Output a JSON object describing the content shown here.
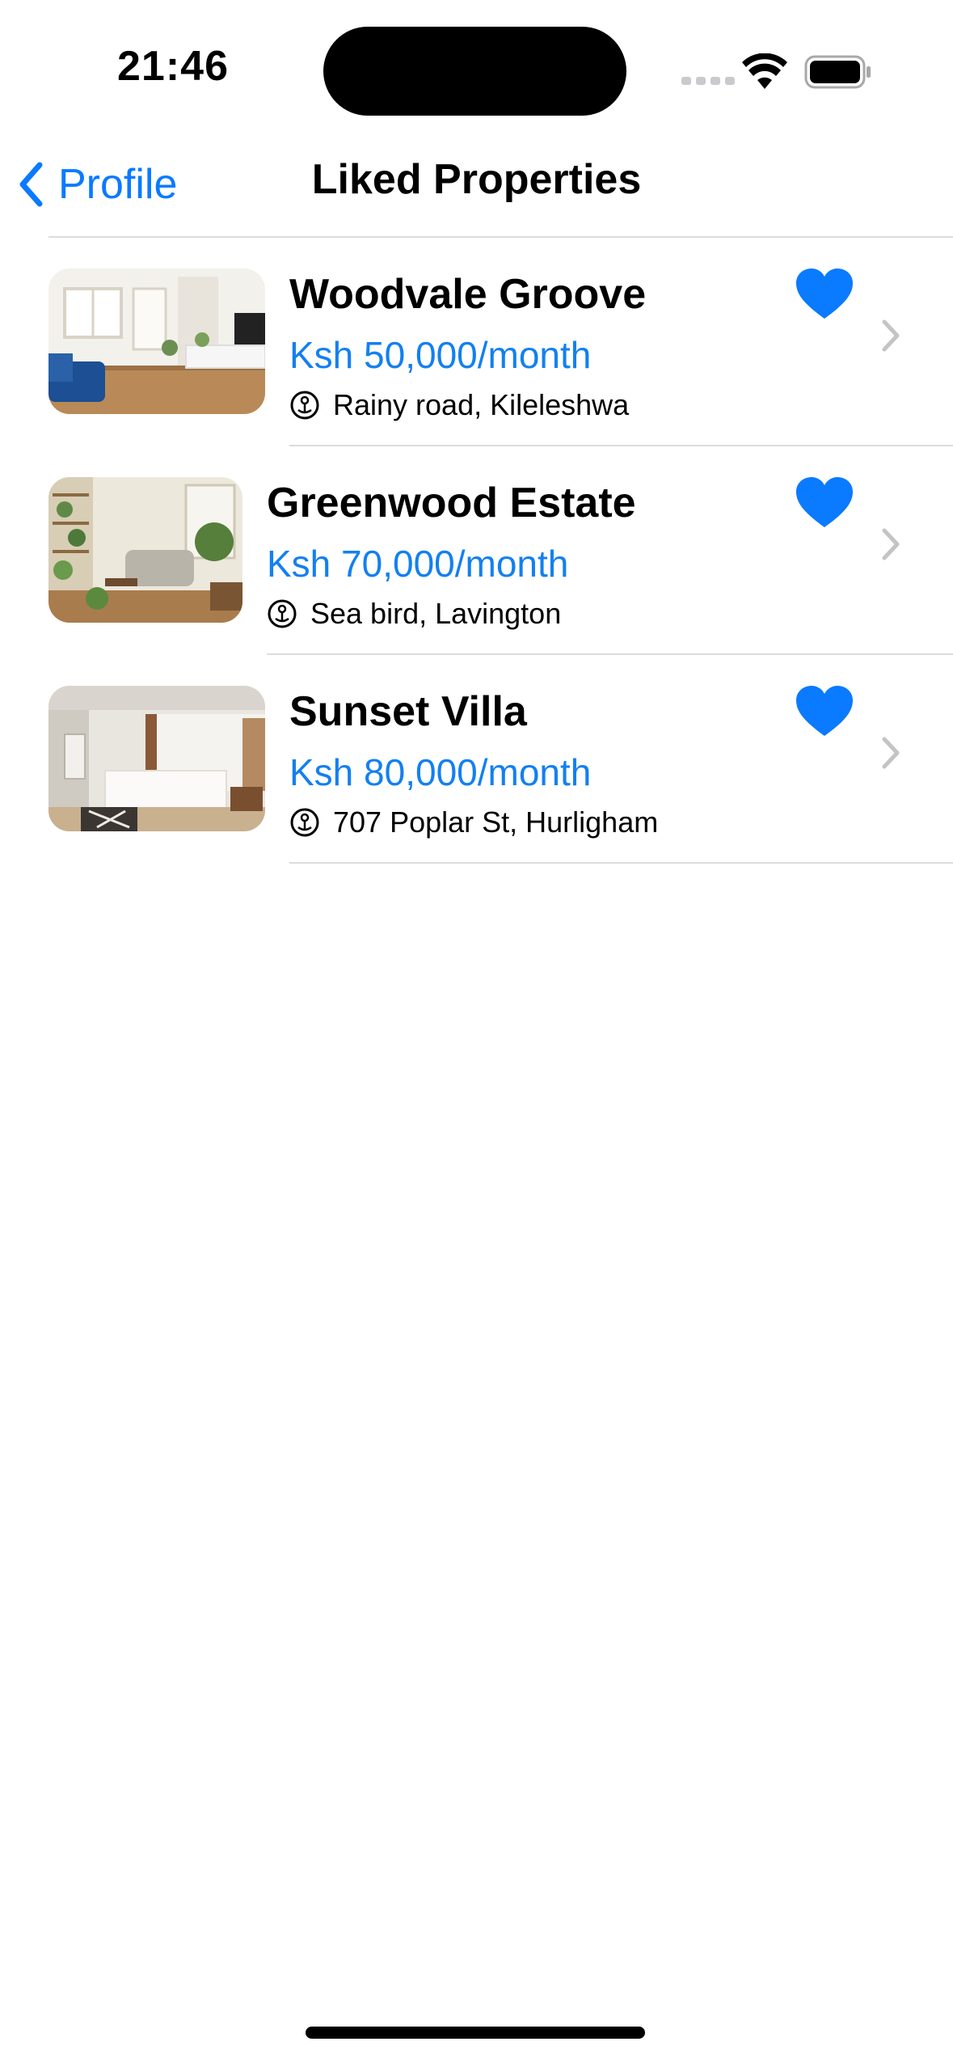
{
  "status_bar": {
    "time": "21:46",
    "icons": [
      "signal-icon",
      "wifi-icon",
      "battery-icon"
    ]
  },
  "nav": {
    "back_label": "Profile",
    "title": "Liked Properties"
  },
  "colors": {
    "accent": "#0a7aff",
    "price": "#1380f0",
    "divider": "#dcdcdf",
    "chevron": "#c4c4c7"
  },
  "properties": [
    {
      "name": "Woodvale Groove",
      "price": "Ksh 50,000/month",
      "address": "Rainy road, Kileleshwa",
      "liked": true,
      "image": "living-room-photo"
    },
    {
      "name": "Greenwood Estate",
      "price": "Ksh 70,000/month",
      "address": "Sea bird, Lavington",
      "liked": true,
      "image": "plant-filled-living-room-photo"
    },
    {
      "name": "Sunset Villa",
      "price": "Ksh 80,000/month",
      "address": "707 Poplar St, Hurligham",
      "liked": true,
      "image": "bedroom-photo"
    }
  ]
}
